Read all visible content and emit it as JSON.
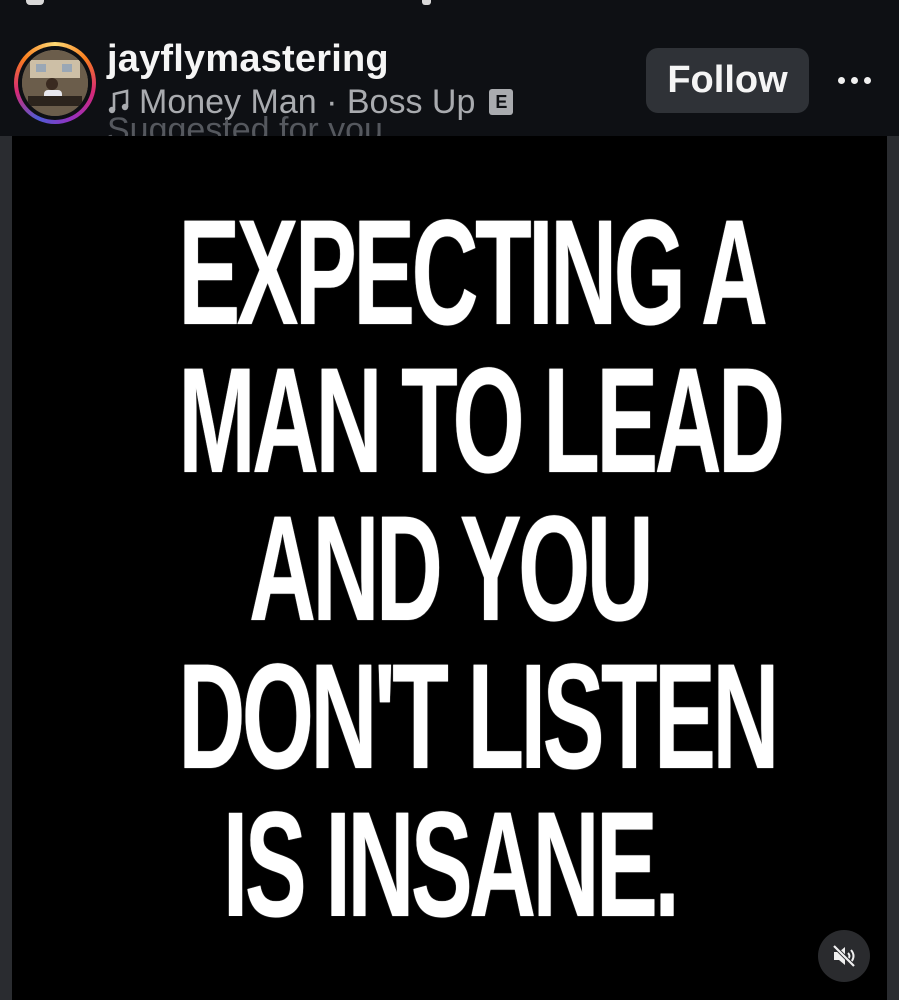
{
  "post": {
    "username": "jayflymastering",
    "music": {
      "icon": "music-note-icon",
      "text": "Money Man · Boss Up",
      "explicit_badge": "E"
    },
    "suggested_text": "Suggested for you",
    "follow_label": "Follow",
    "more_icon": "ellipsis-icon"
  },
  "media": {
    "quote_lines": [
      "EXPECTING A",
      "MAN TO LEAD",
      "AND YOU",
      "DON'T LISTEN",
      "IS INSANE."
    ],
    "mute_icon": "speaker-muted-icon"
  },
  "colors": {
    "background": "#0e1014",
    "follow_button_bg": "#2f3237",
    "text_primary": "#f5f5f5",
    "text_secondary": "#a9abaf",
    "media_bg": "#000000",
    "quote_text": "#ffffff"
  }
}
